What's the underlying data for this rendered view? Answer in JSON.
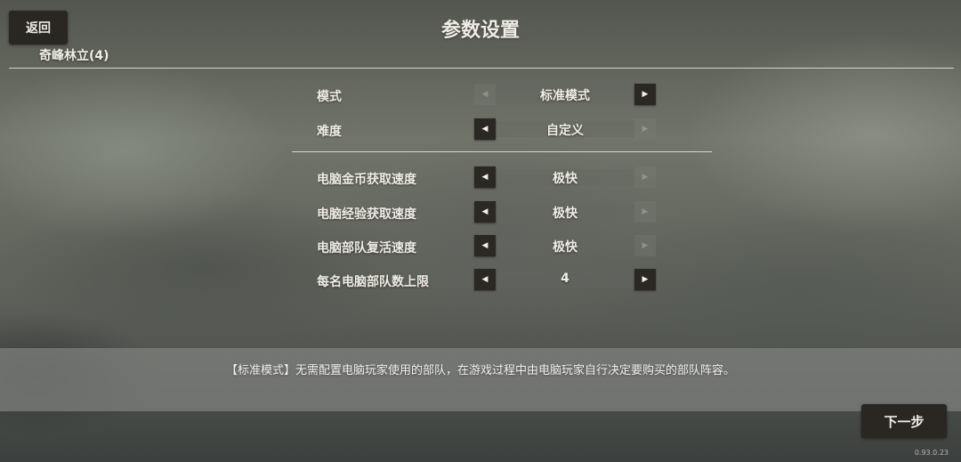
{
  "header": {
    "back_label": "返回",
    "title": "参数设置",
    "map_name": "奇峰林立(4)"
  },
  "settings": [
    {
      "label": "模式",
      "value": "标准模式",
      "left_enabled": false,
      "right_enabled": true
    },
    {
      "label": "难度",
      "value": "自定义",
      "left_enabled": true,
      "right_enabled": false
    },
    {
      "label": "电脑金币获取速度",
      "value": "极快",
      "left_enabled": true,
      "right_enabled": false
    },
    {
      "label": "电脑经验获取速度",
      "value": "极快",
      "left_enabled": true,
      "right_enabled": false
    },
    {
      "label": "电脑部队复活速度",
      "value": "极快",
      "left_enabled": true,
      "right_enabled": false
    },
    {
      "label": "每名电脑部队数上限",
      "value": "4",
      "left_enabled": true,
      "right_enabled": true
    }
  ],
  "description": "【标准模式】无需配置电脑玩家使用的部队，在游戏过程中由电脑玩家自行决定要购买的部队阵容。",
  "footer": {
    "next_label": "下一步",
    "version": "0.93.0.23"
  },
  "icons": {
    "left_arrow": "triangle-left-icon",
    "right_arrow": "triangle-right-icon"
  },
  "colors": {
    "button_bg": "#2a2622",
    "text": "#f0ece4"
  }
}
